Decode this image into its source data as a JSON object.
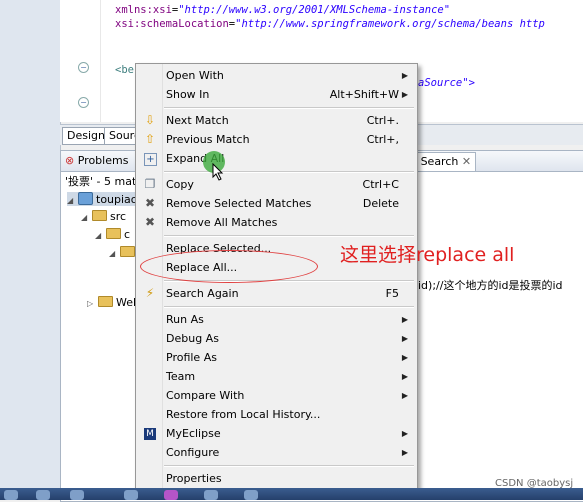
{
  "editor": {
    "lines": [
      {
        "attr": "xmlns:xsi",
        "val": "\"http://www.w3.org/2001/XMLSchema-instance\""
      },
      {
        "attr": "xsi:schemaLocation",
        "val": "\"http://www.springframework.org/schema/beans http"
      },
      {
        "tag": "<be",
        "tail": "aSource\">"
      }
    ],
    "tabs": [
      "Design",
      "Source"
    ]
  },
  "views": {
    "tabs": {
      "problems": "Problems",
      "search": "Search"
    },
    "summary": "'投票' - 5 matc",
    "tree": {
      "project": "toupiao",
      "src": "src",
      "row3": "c",
      "row4": "",
      "web": "Web"
    },
    "code_fragment": "id);//这个地方的id是投票的id"
  },
  "menu": {
    "items": [
      {
        "label": "Open With",
        "submenu": true
      },
      {
        "label": "Show In",
        "accel": "Alt+Shift+W",
        "submenu": true
      },
      {
        "label": "Next Match",
        "accel": "Ctrl+.",
        "icon": "down-arrow-icon"
      },
      {
        "label": "Previous Match",
        "accel": "Ctrl+,",
        "icon": "up-arrow-icon"
      },
      {
        "label": "Expand All",
        "icon": "expand-all-icon"
      },
      {
        "label": "Copy",
        "accel": "Ctrl+C",
        "icon": "copy-icon"
      },
      {
        "label": "Remove Selected Matches",
        "accel": "Delete",
        "icon": "remove-selected-icon"
      },
      {
        "label": "Remove All Matches",
        "icon": "remove-all-icon"
      },
      {
        "label": "Replace Selected..."
      },
      {
        "label": "Replace All..."
      },
      {
        "label": "Search Again",
        "accel": "F5",
        "icon": "search-again-icon"
      },
      {
        "label": "Run As",
        "submenu": true
      },
      {
        "label": "Debug As",
        "submenu": true
      },
      {
        "label": "Profile As",
        "submenu": true
      },
      {
        "label": "Team",
        "submenu": true
      },
      {
        "label": "Compare With",
        "submenu": true
      },
      {
        "label": "Restore from Local History..."
      },
      {
        "label": "MyEclipse",
        "submenu": true,
        "icon": "myeclipse-icon"
      },
      {
        "label": "Configure",
        "submenu": true
      },
      {
        "label": "Properties"
      }
    ]
  },
  "annotation": "这里选择replace all",
  "watermark": "CSDN @taobysj",
  "colors": {
    "annotation": "#e02020",
    "menu_bg": "#f0f0f0"
  }
}
